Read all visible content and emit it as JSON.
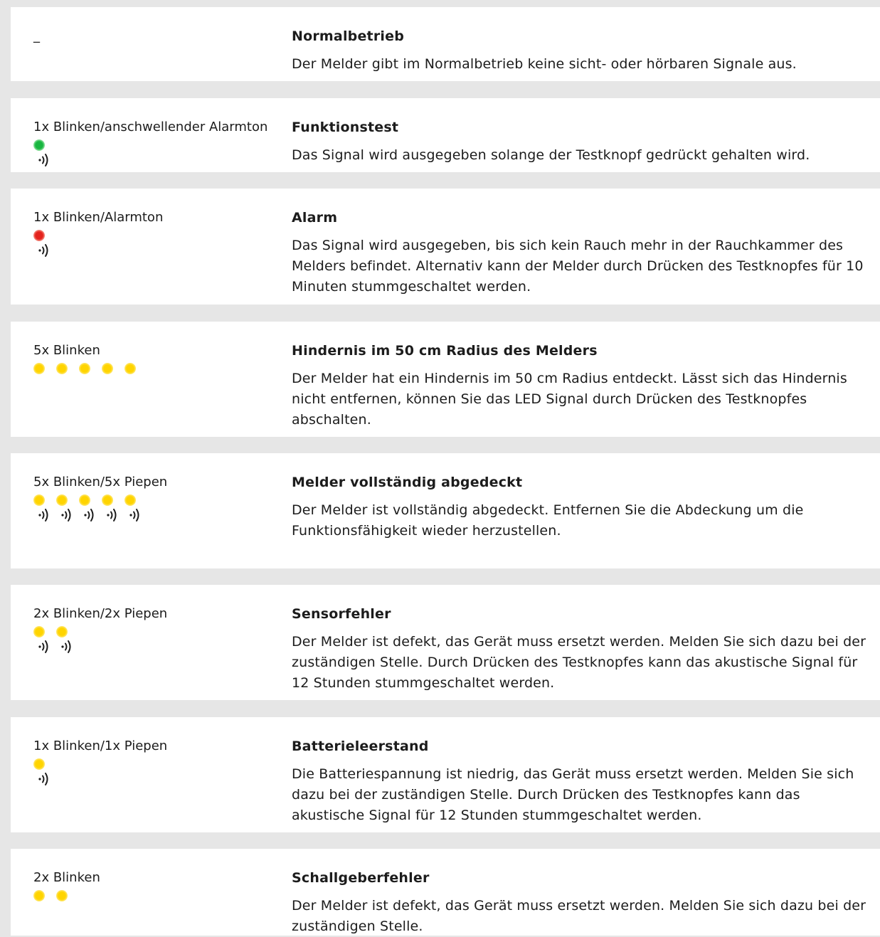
{
  "rows": [
    {
      "signal": "_",
      "indicators": [],
      "title": "Normalbetrieb",
      "description": "Der Melder gibt im Normalbetrieb keine sicht- oder hörbaren Signale aus."
    },
    {
      "signal": "1x Blinken/anschwellender Alarmton",
      "indicators": [
        {
          "led": "green",
          "sound": true
        }
      ],
      "title": "Funktionstest",
      "description": "Das Signal wird ausgegeben solange der Testknopf gedrückt gehalten wird."
    },
    {
      "signal": "1x Blinken/Alarmton",
      "indicators": [
        {
          "led": "red",
          "sound": true
        }
      ],
      "title": "Alarm",
      "description": "Das Signal wird ausgegeben, bis sich kein Rauch mehr in der Rauchkammer des Melders befindet. Alternativ kann der Melder durch Drücken des Test­knopfes für 10 Minuten stummgeschaltet werden."
    },
    {
      "signal": "5x Blinken",
      "indicators": [
        {
          "led": "yellow",
          "sound": false
        },
        {
          "led": "yellow",
          "sound": false
        },
        {
          "led": "yellow",
          "sound": false
        },
        {
          "led": "yellow",
          "sound": false
        },
        {
          "led": "yellow",
          "sound": false
        }
      ],
      "title": "Hindernis im 50 cm Radius des Melders",
      "description": "Der Melder hat ein Hindernis im 50 cm Radius entdeckt. Lässt sich das Hindernis nicht entfernen, können Sie das LED Signal durch Drücken des Testknopfes abschalten."
    },
    {
      "signal": "5x Blinken/5x Piepen",
      "indicators": [
        {
          "led": "yellow",
          "sound": true
        },
        {
          "led": "yellow",
          "sound": true
        },
        {
          "led": "yellow",
          "sound": true
        },
        {
          "led": "yellow",
          "sound": true
        },
        {
          "led": "yellow",
          "sound": true
        }
      ],
      "title": "Melder vollständig abgedeckt",
      "description": "Der Melder ist vollständig abgedeckt. Entfernen Sie die Abdeckung um die Funktionsfähigkeit wieder herzustellen."
    },
    {
      "signal": "2x Blinken/2x Piepen",
      "indicators": [
        {
          "led": "yellow",
          "sound": true
        },
        {
          "led": "yellow",
          "sound": true
        }
      ],
      "title": "Sensorfehler",
      "description": "Der Melder ist defekt, das Gerät muss ersetzt werden. Melden Sie sich dazu bei der zuständigen Stelle. Durch Drücken des Testknopfes kann das akustische Signal für 12 Stunden stummgeschaltet werden."
    },
    {
      "signal": "1x Blinken/1x Piepen",
      "indicators": [
        {
          "led": "yellow",
          "sound": true
        }
      ],
      "title": "Batterieleerstand",
      "description": "Die Batteriespannung ist niedrig, das Gerät muss ersetzt werden. Melden Sie sich dazu bei der zuständigen Stelle. Durch Drücken des Testknopfes kann das akustische Signal für 12 Stunden stummgeschaltet werden."
    },
    {
      "signal": "2x Blinken",
      "indicators": [
        {
          "led": "yellow",
          "sound": false
        },
        {
          "led": "yellow",
          "sound": false
        }
      ],
      "title": "Schallgeberfehler",
      "description": "Der Melder ist defekt, das Gerät muss ersetzt werden. Melden Sie sich dazu bei der zuständigen Stelle."
    }
  ]
}
